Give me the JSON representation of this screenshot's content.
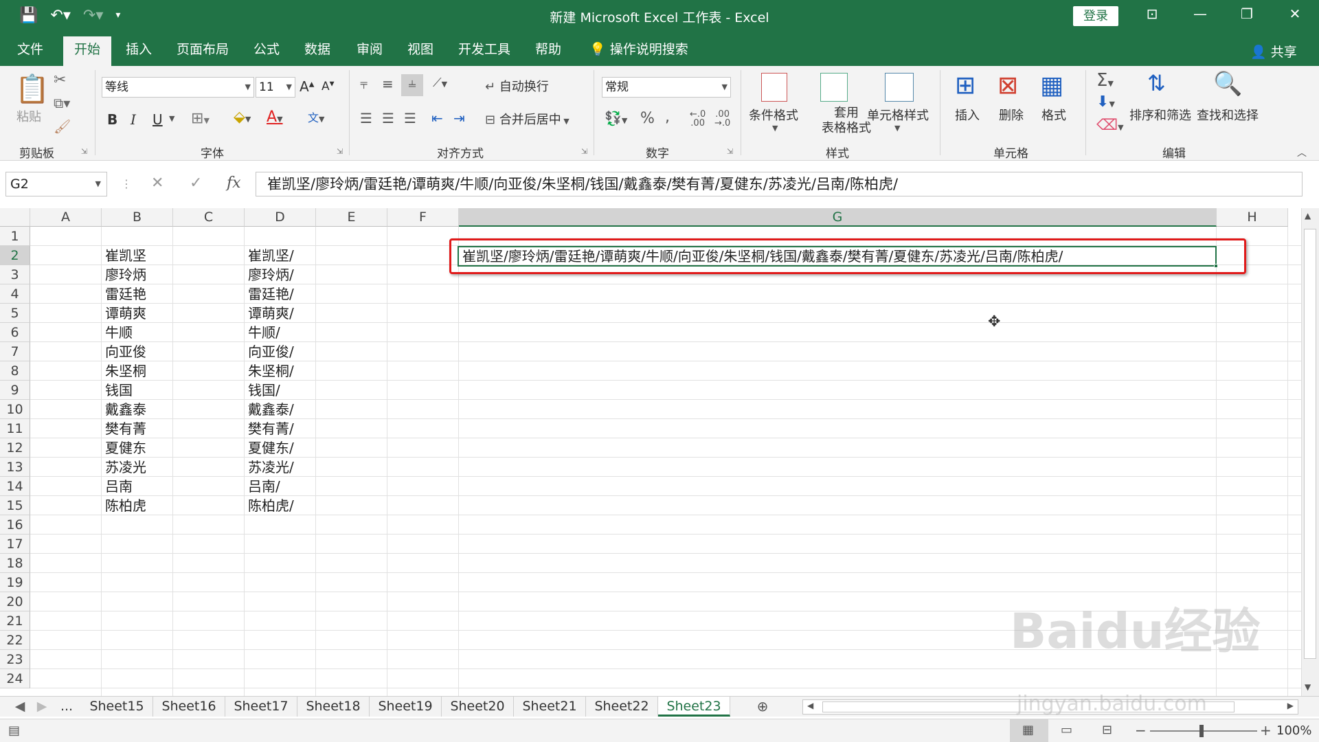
{
  "window": {
    "title": "新建 Microsoft Excel 工作表  -  Excel",
    "login_label": "登录",
    "share_label": "共享",
    "accent_color": "#217346"
  },
  "tabs": [
    "文件",
    "开始",
    "插入",
    "页面布局",
    "公式",
    "数据",
    "审阅",
    "视图",
    "开发工具",
    "帮助",
    "操作说明搜索"
  ],
  "active_tab": "开始",
  "ribbon": {
    "clipboard": {
      "paste": "粘贴",
      "label": "剪贴板"
    },
    "font": {
      "name": "等线",
      "size": "11",
      "label": "字体",
      "bold": "B",
      "italic": "I",
      "underline": "U"
    },
    "alignment": {
      "wrap": "自动换行",
      "merge": "合并后居中",
      "label": "对齐方式"
    },
    "number": {
      "format": "常规",
      "label": "数字"
    },
    "styles": {
      "conditional": "条件格式",
      "table_line1": "套用",
      "table_line2": "表格格式",
      "cell_style": "单元格样式",
      "label": "样式"
    },
    "cells": {
      "insert": "插入",
      "delete": "删除",
      "format": "格式",
      "label": "单元格"
    },
    "editing": {
      "sort": "排序和筛选",
      "find": "查找和选择",
      "label": "编辑"
    }
  },
  "formula_bar": {
    "name_box": "G2",
    "content": "崔凯坚/廖玲炳/雷廷艳/谭萌爽/牛顺/向亚俊/朱坚桐/钱国/戴鑫泰/樊有菁/夏健东/苏凌光/吕南/陈柏虎/"
  },
  "columns": [
    "A",
    "B",
    "C",
    "D",
    "E",
    "F",
    "G",
    "H"
  ],
  "rows": [
    "1",
    "2",
    "3",
    "4",
    "5",
    "6",
    "7",
    "8",
    "9",
    "10",
    "11",
    "12",
    "13",
    "14",
    "15",
    "16",
    "17",
    "18",
    "19",
    "20",
    "21",
    "22",
    "23",
    "24"
  ],
  "cells": {
    "B": [
      "崔凯坚",
      "廖玲炳",
      "雷廷艳",
      "谭萌爽",
      "牛顺",
      "向亚俊",
      "朱坚桐",
      "钱国",
      "戴鑫泰",
      "樊有菁",
      "夏健东",
      "苏凌光",
      "吕南",
      "陈柏虎"
    ],
    "D": [
      "崔凯坚/",
      "廖玲炳/",
      "雷廷艳/",
      "谭萌爽/",
      "牛顺/",
      "向亚俊/",
      "朱坚桐/",
      "钱国/",
      "戴鑫泰/",
      "樊有菁/",
      "夏健东/",
      "苏凌光/",
      "吕南/",
      "陈柏虎/"
    ],
    "G2": "崔凯坚/廖玲炳/雷廷艳/谭萌爽/牛顺/向亚俊/朱坚桐/钱国/戴鑫泰/樊有菁/夏健东/苏凌光/吕南/陈柏虎/"
  },
  "sheets": [
    "Sheet15",
    "Sheet16",
    "Sheet17",
    "Sheet18",
    "Sheet19",
    "Sheet20",
    "Sheet21",
    "Sheet22",
    "Sheet23"
  ],
  "active_sheet": "Sheet23",
  "status": {
    "zoom": "100%"
  },
  "watermark": {
    "logo": "Baidu经验",
    "url": "jingyan.baidu.com"
  }
}
